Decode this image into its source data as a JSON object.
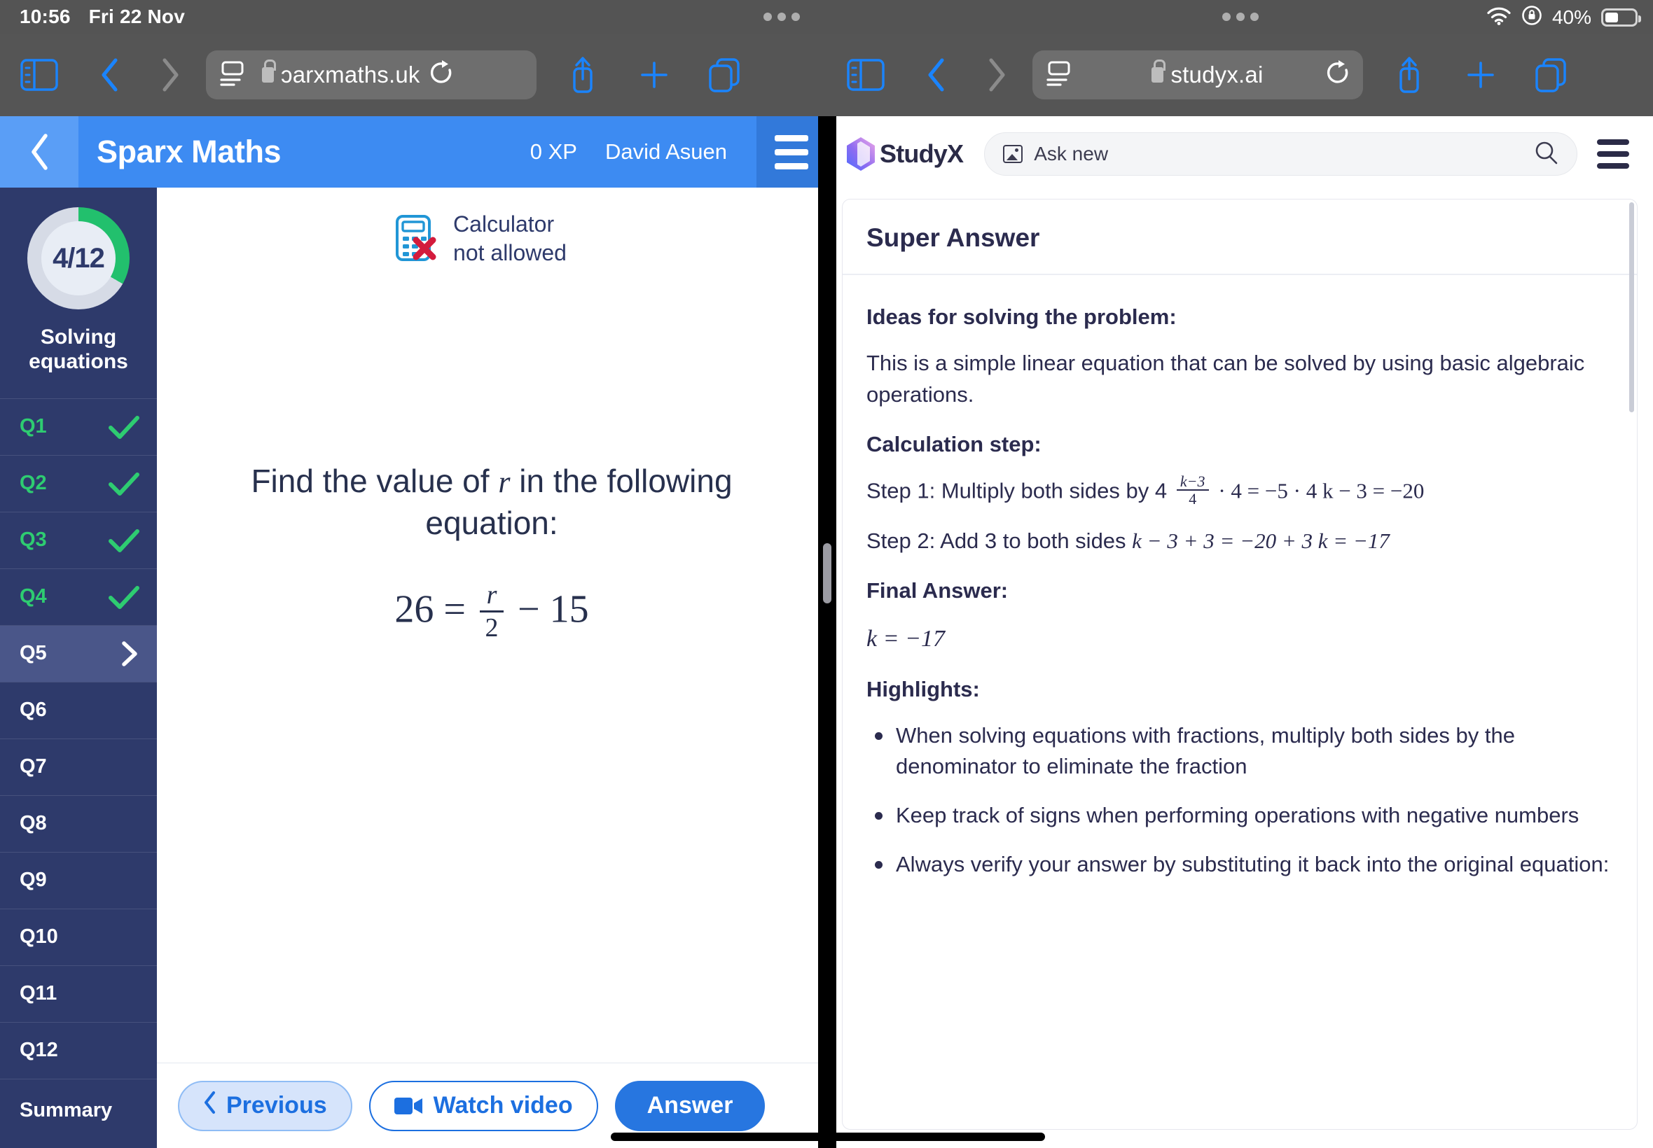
{
  "status_bar": {
    "time": "10:56",
    "date": "Fri 22 Nov",
    "battery_percent": "40%",
    "wifi_icon": "wifi-icon",
    "rotation_lock_icon": "rotation-lock-icon",
    "battery_icon": "battery-icon",
    "multitask_dots_icon": "multitask-handle-icon"
  },
  "browser_left": {
    "sidebar_icon": "sidebar-toggle-icon",
    "back_icon": "back-chevron-icon",
    "forward_icon": "forward-chevron-icon",
    "reader_icon": "page-settings-icon",
    "lock_icon": "lock-icon",
    "url": "ɔarxmaths.uk",
    "reload_icon": "reload-icon",
    "share_icon": "share-icon",
    "new_tab_icon": "plus-icon",
    "tabs_icon": "tabs-icon"
  },
  "browser_right": {
    "sidebar_icon": "sidebar-toggle-icon",
    "back_icon": "back-chevron-icon",
    "forward_icon": "forward-chevron-icon",
    "reader_icon": "page-settings-icon",
    "lock_icon": "lock-icon",
    "url": "studyx.ai",
    "reload_icon": "reload-icon",
    "share_icon": "share-icon",
    "new_tab_icon": "plus-icon",
    "tabs_icon": "tabs-icon"
  },
  "sparx": {
    "header": {
      "back_icon": "back-chevron-icon",
      "title": "Sparx Maths",
      "xp": "0 XP",
      "user": "David Asuen",
      "menu_icon": "hamburger-menu-icon"
    },
    "progress": {
      "value": "4/12",
      "completed": 4,
      "total": 12,
      "topic": "Solving equations",
      "ring_color": "#22c06d",
      "ring_track_color": "#d6dbe6"
    },
    "questions": [
      {
        "label": "Q1",
        "state": "done",
        "mark": "check-icon"
      },
      {
        "label": "Q2",
        "state": "done",
        "mark": "check-icon"
      },
      {
        "label": "Q3",
        "state": "done",
        "mark": "check-icon"
      },
      {
        "label": "Q4",
        "state": "done",
        "mark": "check-icon"
      },
      {
        "label": "Q5",
        "state": "active",
        "mark": "chevron-right-icon"
      },
      {
        "label": "Q6",
        "state": "pending",
        "mark": ""
      },
      {
        "label": "Q7",
        "state": "pending",
        "mark": ""
      },
      {
        "label": "Q8",
        "state": "pending",
        "mark": ""
      },
      {
        "label": "Q9",
        "state": "pending",
        "mark": ""
      },
      {
        "label": "Q10",
        "state": "pending",
        "mark": ""
      },
      {
        "label": "Q11",
        "state": "pending",
        "mark": ""
      },
      {
        "label": "Q12",
        "state": "pending",
        "mark": ""
      }
    ],
    "summary_label": "Summary",
    "calculator": {
      "icon": "calculator-not-allowed-icon",
      "line1": "Calculator",
      "line2": "not allowed"
    },
    "question": {
      "prompt_before": "Find the value of ",
      "prompt_variable": "r",
      "prompt_after": " in the following equation:",
      "equation_lhs": "26 =",
      "equation_numerator": "r",
      "equation_denominator": "2",
      "equation_tail": "− 15"
    },
    "footer": {
      "previous_label": "Previous",
      "previous_icon": "chevron-left-icon",
      "watch_video_label": "Watch video",
      "watch_video_icon": "video-camera-icon",
      "answer_label": "Answer"
    }
  },
  "studyx": {
    "brand": "StudyX",
    "logo_icon": "studyx-gem-logo-icon",
    "search_placeholder": "Ask new",
    "search_image_icon": "image-icon",
    "search_icon": "search-icon",
    "menu_icon": "hamburger-menu-icon",
    "card_title": "Super Answer",
    "sections": {
      "ideas_heading": "Ideas for solving the problem:",
      "ideas_text": "This is a simple linear equation that can be solved by using basic algebraic operations.",
      "calculation_heading": "Calculation step:",
      "step1_text": "Step 1: Multiply both sides by 4",
      "step1_num": "k−3",
      "step1_den": "4",
      "step1_math_tail": "· 4 = −5 · 4 k − 3 = −20",
      "step2_text": "Step 2: Add 3 to both sides",
      "step2_math": "k − 3 + 3 = −20 + 3 k = −17",
      "final_heading": "Final Answer:",
      "final_answer": "k = −17",
      "highlights_heading": "Highlights:",
      "highlights": [
        "When solving equations with fractions, multiply both sides by the denominator to eliminate the fraction",
        "Keep track of signs when performing operations with negative numbers",
        "Always verify your answer by substituting it back into the original equation:"
      ]
    }
  },
  "colors": {
    "sparx_blue": "#3d8bf2",
    "sidebar_navy": "#2e3a6b",
    "green": "#2ecc71",
    "answer_blue": "#2776e0",
    "studyx_ink": "#2b2b4e",
    "toolbar_gray": "#555555"
  }
}
